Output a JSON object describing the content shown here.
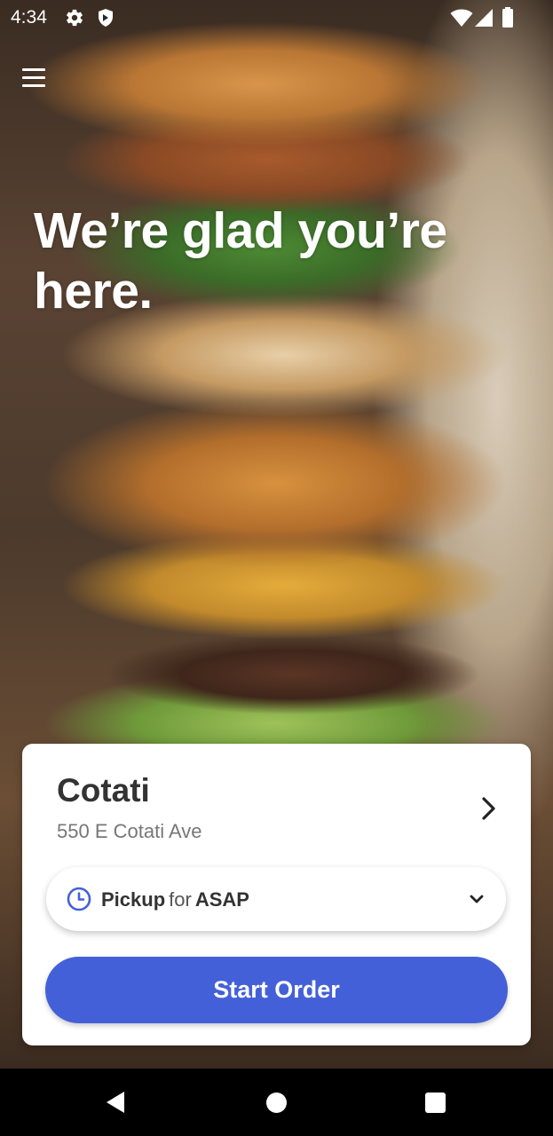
{
  "status_bar": {
    "time": "4:34",
    "icons": [
      "gear-icon",
      "shield-icon",
      "wifi-icon",
      "signal-icon",
      "battery-icon"
    ]
  },
  "header": {
    "menu_icon": "hamburger-menu-icon"
  },
  "hero": {
    "headline": "We’re glad you’re here."
  },
  "location_card": {
    "name": "Cotati",
    "address": "550 E Cotati Ave",
    "chevron_icon": "chevron-right-icon",
    "pickup": {
      "icon": "clock-icon",
      "mode": "Pickup",
      "connector": "for",
      "time": "ASAP",
      "caret_icon": "chevron-down-icon"
    },
    "start_order_label": "Start Order"
  },
  "nav_bar": {
    "buttons": [
      "back-icon",
      "home-icon",
      "recent-apps-icon"
    ]
  },
  "colors": {
    "accent": "#4460d9",
    "card_background": "#ffffff",
    "text_primary": "#333333",
    "text_secondary": "#777777"
  }
}
